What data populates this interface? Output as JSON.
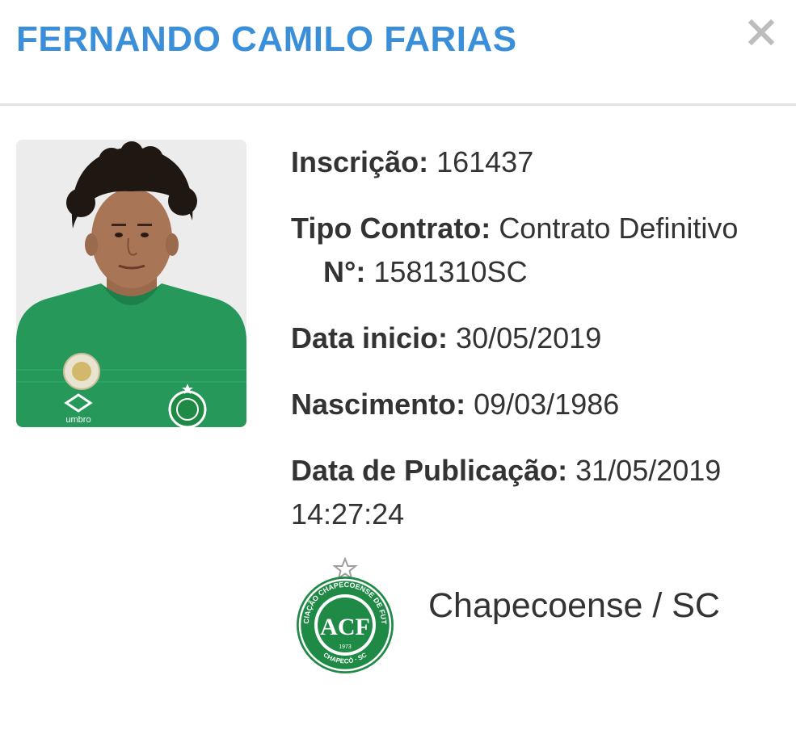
{
  "modal": {
    "title": "FERNANDO CAMILO FARIAS",
    "close_icon": "close-icon"
  },
  "player": {
    "photo_icon": "player-photo",
    "jersey_brand": "umbro",
    "fields": {
      "inscricao": {
        "label": "Inscrição:",
        "value": "161437"
      },
      "tipo_contrato": {
        "label": "Tipo Contrato:",
        "value": "Contrato Definitivo"
      },
      "numero": {
        "label": "N°:",
        "value": "1581310SC"
      },
      "data_inicio": {
        "label": "Data inicio:",
        "value": "30/05/2019"
      },
      "nascimento": {
        "label": "Nascimento:",
        "value": "09/03/1986"
      },
      "data_publicacao": {
        "label": "Data de Publicação:",
        "value": "31/05/2019 14:27:24"
      }
    }
  },
  "club": {
    "name": "Chapecoense / SC",
    "crest": {
      "icon": "club-crest-icon",
      "monogram": "ACF",
      "ring_text": "ASSOCIAÇÃO CHAPECOENSE DE FUTEBOL",
      "year": "1973",
      "city": "CHAPECÓ · SC"
    }
  },
  "colors": {
    "title_blue": "#3a8fd8",
    "text": "#333333",
    "divider": "#e3e3e3",
    "club_green": "#1f8a45",
    "close_gray": "#bdbdbd"
  }
}
